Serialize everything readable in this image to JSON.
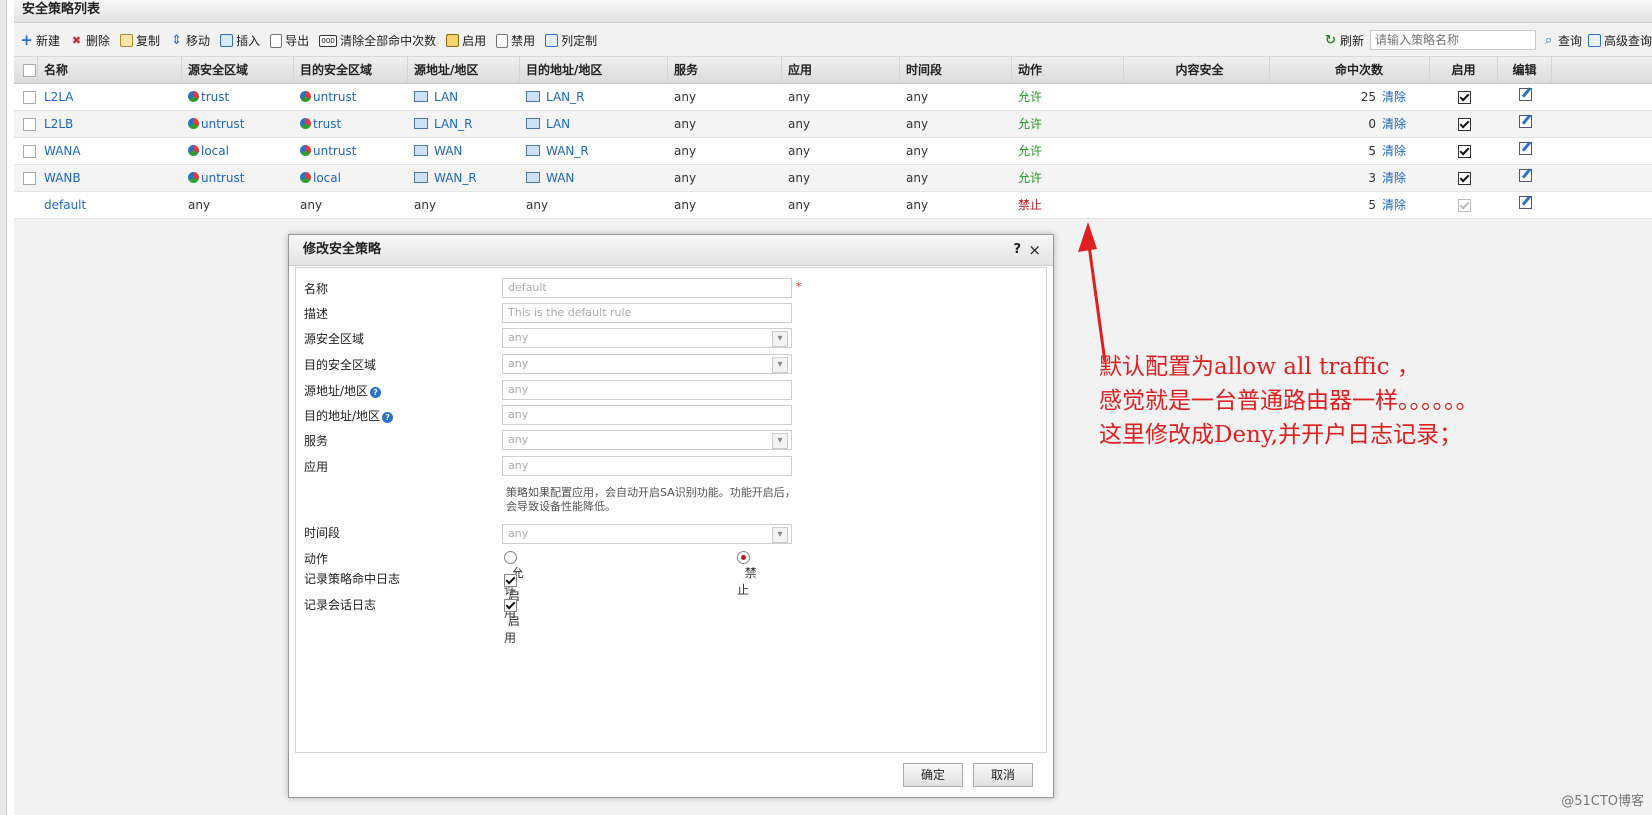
{
  "panel": {
    "title": "安全策略列表"
  },
  "toolbar": {
    "new": "新建",
    "delete": "删除",
    "copy": "复制",
    "move": "移动",
    "insert": "插入",
    "export": "导出",
    "clear_hits": "清除全部命中次数",
    "enable": "启用",
    "disable": "禁用",
    "columns": "列定制",
    "refresh": "刷新",
    "search_placeholder": "请输入策略名称",
    "query": "查询",
    "advanced_query": "高级查询"
  },
  "columns": [
    "名称",
    "源安全区域",
    "目的安全区域",
    "源地址/地区",
    "目的地址/地区",
    "服务",
    "应用",
    "时间段",
    "动作",
    "内容安全",
    "命中次数",
    "启用",
    "编辑"
  ],
  "rows": [
    {
      "name": "L2LA",
      "src_zone": "trust",
      "dst_zone": "untrust",
      "src_addr": "LAN",
      "dst_addr": "LAN_R",
      "service": "any",
      "app": "any",
      "time": "any",
      "action": "允许",
      "hits": "25",
      "clear": "清除"
    },
    {
      "name": "L2LB",
      "src_zone": "untrust",
      "dst_zone": "trust",
      "src_addr": "LAN_R",
      "dst_addr": "LAN",
      "service": "any",
      "app": "any",
      "time": "any",
      "action": "允许",
      "hits": "0",
      "clear": "清除"
    },
    {
      "name": "WANA",
      "src_zone": "local",
      "dst_zone": "untrust",
      "src_addr": "WAN",
      "dst_addr": "WAN_R",
      "service": "any",
      "app": "any",
      "time": "any",
      "action": "允许",
      "hits": "5",
      "clear": "清除"
    },
    {
      "name": "WANB",
      "src_zone": "untrust",
      "dst_zone": "local",
      "src_addr": "WAN_R",
      "dst_addr": "WAN",
      "service": "any",
      "app": "any",
      "time": "any",
      "action": "允许",
      "hits": "3",
      "clear": "清除"
    },
    {
      "name": "default",
      "src_zone": "any",
      "dst_zone": "any",
      "src_addr": "any",
      "dst_addr": "any",
      "service": "any",
      "app": "any",
      "time": "any",
      "action": "禁止",
      "hits": "5",
      "clear": "清除"
    }
  ],
  "dialog": {
    "title": "修改安全策略",
    "help": "?",
    "close": "×",
    "labels": {
      "name": "名称",
      "desc": "描述",
      "src_zone": "源安全区域",
      "dst_zone": "目的安全区域",
      "src_addr": "源地址/地区",
      "dst_addr": "目的地址/地区",
      "service": "服务",
      "app": "应用",
      "time": "时间段",
      "action": "动作",
      "log_hit": "记录策略命中日志",
      "log_session": "记录会话日志"
    },
    "values": {
      "name": "default",
      "desc": "This is the default rule",
      "src_zone": "any",
      "dst_zone": "any",
      "src_addr": "any",
      "dst_addr": "any",
      "service": "any",
      "app": "any",
      "time": "any"
    },
    "required_mark": "*",
    "app_hint": "策略如果配置应用，会自动开启SA识别功能。功能开启后，会导致设备性能降低。",
    "action_allow": "允许",
    "action_deny": "禁止",
    "action_selected": "禁止",
    "log_hit_label": "启用",
    "log_session_label": "启用",
    "ok": "确定",
    "cancel": "取消"
  },
  "annotation": {
    "line1": "默认配置为allow all traffic ，",
    "line2": "感觉就是一台普通路由器一样。。。。。。",
    "line3": "这里修改成Deny,并开户日志记录；"
  },
  "watermark": "@51CTO博客",
  "colors": {
    "link": "#1c67c4",
    "allow": "#1e9b1e",
    "deny": "#c01818",
    "annotation": "#e02020"
  }
}
